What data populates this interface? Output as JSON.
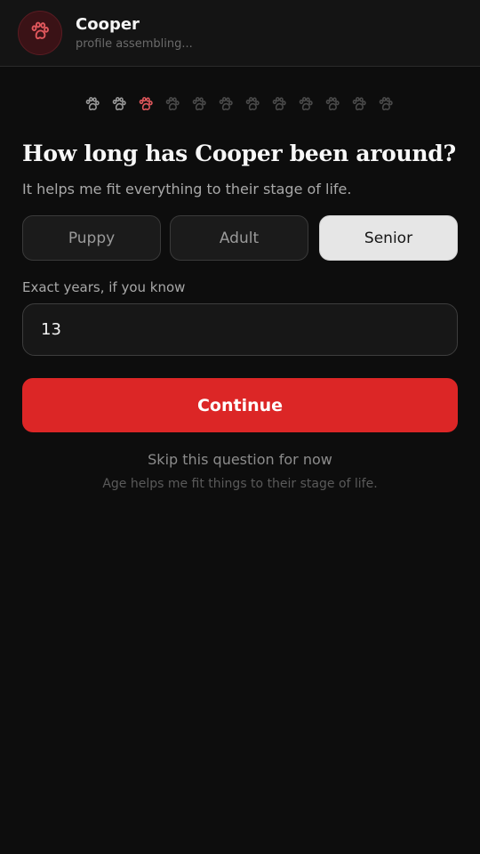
{
  "header": {
    "name": "Cooper",
    "subtitle": "profile assembling...",
    "avatar_icon": "paw-icon"
  },
  "progress": {
    "total_steps": 12,
    "current_step": 3,
    "icon": "paw-icon",
    "colors": {
      "done": "#9a9a9a",
      "current": "#e0575c",
      "upcoming": "#4a4a4a"
    }
  },
  "question": {
    "title": "How long has Cooper been around?",
    "subtitle": "It helps me fit everything to their stage of life."
  },
  "life_stage": {
    "options": [
      "Puppy",
      "Adult",
      "Senior"
    ],
    "selected": "Senior"
  },
  "years": {
    "label": "Exact years, if you know",
    "value": "13"
  },
  "actions": {
    "continue_label": "Continue",
    "skip_label": "Skip this question for now",
    "hint": "Age helps me fit things to their stage of life."
  },
  "colors": {
    "accent": "#dc2626",
    "background": "#0d0d0d"
  }
}
